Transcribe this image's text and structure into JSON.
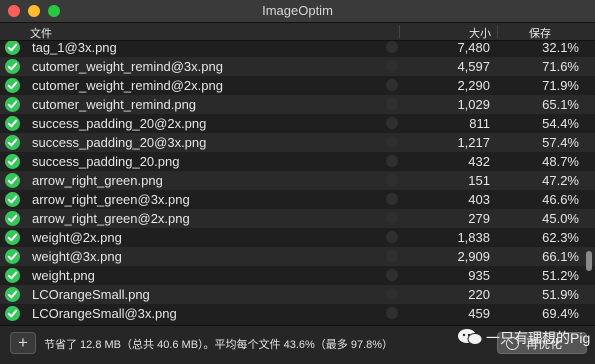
{
  "window": {
    "title": "ImageOptim"
  },
  "columns": {
    "file": "文件",
    "size": "大小",
    "savings": "保存"
  },
  "rows": [
    {
      "name": "tag_1@3x.png",
      "size": "7,480",
      "savings": "32.1%"
    },
    {
      "name": "cutomer_weight_remind@3x.png",
      "size": "4,597",
      "savings": "71.6%"
    },
    {
      "name": "cutomer_weight_remind@2x.png",
      "size": "2,290",
      "savings": "71.9%"
    },
    {
      "name": "cutomer_weight_remind.png",
      "size": "1,029",
      "savings": "65.1%"
    },
    {
      "name": "success_padding_20@2x.png",
      "size": "811",
      "savings": "54.4%"
    },
    {
      "name": "success_padding_20@3x.png",
      "size": "1,217",
      "savings": "57.4%"
    },
    {
      "name": "success_padding_20.png",
      "size": "432",
      "savings": "48.7%"
    },
    {
      "name": "arrow_right_green.png",
      "size": "151",
      "savings": "47.2%"
    },
    {
      "name": "arrow_right_green@3x.png",
      "size": "403",
      "savings": "46.6%"
    },
    {
      "name": "arrow_right_green@2x.png",
      "size": "279",
      "savings": "45.0%"
    },
    {
      "name": "weight@2x.png",
      "size": "1,838",
      "savings": "62.3%"
    },
    {
      "name": "weight@3x.png",
      "size": "2,909",
      "savings": "66.1%"
    },
    {
      "name": "weight.png",
      "size": "935",
      "savings": "51.2%"
    },
    {
      "name": "LCOrangeSmall.png",
      "size": "220",
      "savings": "51.9%"
    },
    {
      "name": "LCOrangeSmall@3x.png",
      "size": "459",
      "savings": "69.4%"
    }
  ],
  "footer": {
    "add_label": "+",
    "summary": "节省了 12.8 MB（总共 40.6 MB）。平均每个文件 43.6%（最多 97.8%）",
    "reoptimize_label": "再优化"
  },
  "watermark": {
    "text": "一只有理想的Pig"
  },
  "colors": {
    "status_ok": "#35c759",
    "close": "#ff5f57",
    "minimize": "#febc2e",
    "maximize": "#28c840"
  },
  "icons": {
    "status": "checkmark-circle-icon",
    "add": "plus-icon",
    "reoptimize": "refresh-icon",
    "watermark": "wechat-icon"
  }
}
